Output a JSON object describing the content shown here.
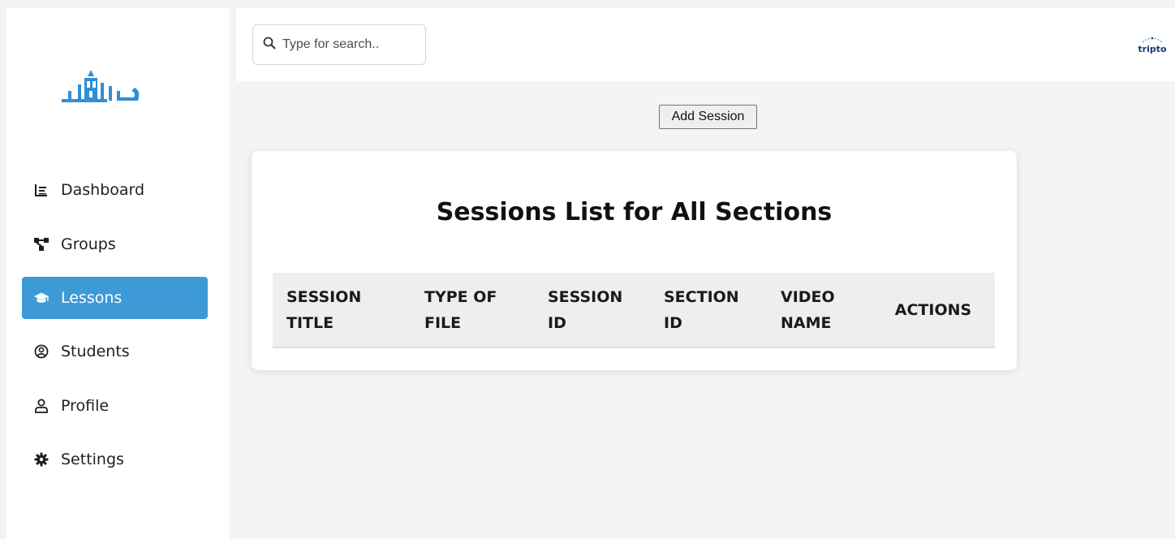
{
  "sidebar": {
    "logo_name": "app-logo",
    "items": [
      {
        "label": "Dashboard",
        "icon": "dashboard-icon",
        "active": false
      },
      {
        "label": "Groups",
        "icon": "groups-icon",
        "active": false
      },
      {
        "label": "Lessons",
        "icon": "graduation-cap-icon",
        "active": true
      },
      {
        "label": "Students",
        "icon": "user-circle-icon",
        "active": false
      },
      {
        "label": "Profile",
        "icon": "user-icon",
        "active": false
      },
      {
        "label": "Settings",
        "icon": "gear-icon",
        "active": false
      }
    ]
  },
  "header": {
    "search_placeholder": "Type for search..",
    "brand_text": "tripto"
  },
  "main": {
    "add_button_label": "Add Session",
    "card_title": "Sessions List for All Sections",
    "table_headers": [
      [
        "SESSION",
        "TITLE"
      ],
      [
        "TYPE OF",
        "FILE"
      ],
      [
        "SESSION",
        "ID"
      ],
      [
        "SECTION",
        "ID"
      ],
      [
        "VIDEO",
        "NAME"
      ],
      [
        "ACTIONS"
      ]
    ]
  },
  "colors": {
    "accent": "#3d9ad7",
    "background": "#f2f4f5",
    "logo": "#2f8fd6"
  }
}
